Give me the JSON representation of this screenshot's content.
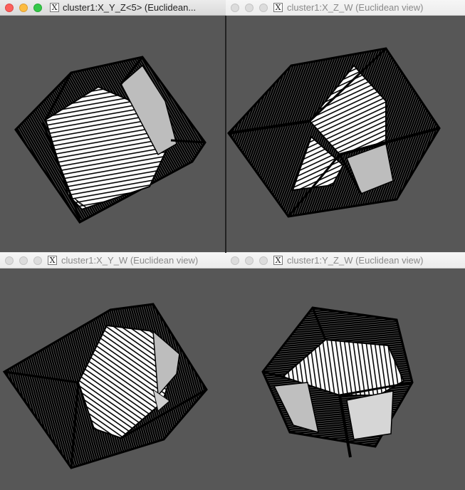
{
  "desktop": {
    "background": "#e6e6e6"
  },
  "viewport_background": "#575757",
  "windows": [
    {
      "id": "xyz",
      "title": "cluster1:X_Y_Z<5> (Euclidean...",
      "active": true
    },
    {
      "id": "xzw",
      "title": "cluster1:X_Z_W (Euclidean view)",
      "active": false
    },
    {
      "id": "xyw",
      "title": "cluster1:X_Y_W (Euclidean view)",
      "active": false
    },
    {
      "id": "yzw",
      "title": "cluster1:Y_Z_W (Euclidean view)",
      "active": false
    }
  ],
  "icons": {
    "app": "x11-icon",
    "close": "close-icon",
    "minimize": "minimize-icon",
    "zoom": "zoom-icon"
  },
  "colors": {
    "close": "#fc605c",
    "minimize": "#fdbc40",
    "zoom": "#34c84a",
    "wire": "#000000",
    "face": "#ffffff"
  }
}
